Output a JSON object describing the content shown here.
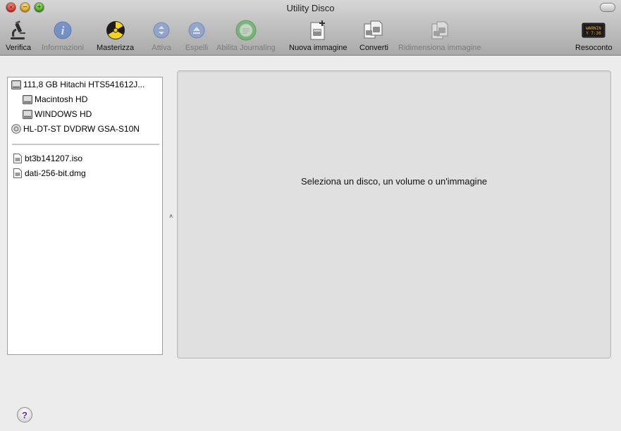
{
  "window": {
    "title": "Utility Disco"
  },
  "toolbar": {
    "items": [
      {
        "label": "Verifica",
        "icon": "microscope-icon",
        "enabled": true
      },
      {
        "label": "Informazioni",
        "icon": "info-icon",
        "enabled": false
      },
      {
        "label": "Masterizza",
        "icon": "burn-icon",
        "enabled": true
      },
      {
        "label": "Attiva",
        "icon": "mount-icon",
        "enabled": false
      },
      {
        "label": "Espelli",
        "icon": "eject-icon",
        "enabled": false
      },
      {
        "label": "Abilita Journaling",
        "icon": "journaling-icon",
        "enabled": false
      },
      {
        "label": "Nuova immagine",
        "icon": "new-image-icon",
        "enabled": true
      },
      {
        "label": "Converti",
        "icon": "convert-icon",
        "enabled": true
      },
      {
        "label": "Ridimensiona immagine",
        "icon": "resize-image-icon",
        "enabled": false
      },
      {
        "label": "Resoconto",
        "icon": "log-icon",
        "enabled": true
      }
    ],
    "log_icon_text": [
      "WARNIN",
      "Y 7:36"
    ]
  },
  "sidebar": {
    "disks": [
      {
        "label": "111,8 GB Hitachi HTS541612J...",
        "icon": "hard-disk-icon",
        "level": 0
      },
      {
        "label": "Macintosh HD",
        "icon": "volume-icon",
        "level": 1
      },
      {
        "label": "WINDOWS HD",
        "icon": "volume-icon",
        "level": 1
      },
      {
        "label": "HL-DT-ST DVDRW GSA-S10N",
        "icon": "optical-drive-icon",
        "level": 0
      }
    ],
    "images": [
      {
        "label": "bt3b141207.iso",
        "icon": "document-icon"
      },
      {
        "label": "dati-256-bit.dmg",
        "icon": "document-icon"
      }
    ]
  },
  "main": {
    "message": "Seleziona un disco, un volume o un'immagine"
  },
  "help": {
    "label": "?"
  }
}
